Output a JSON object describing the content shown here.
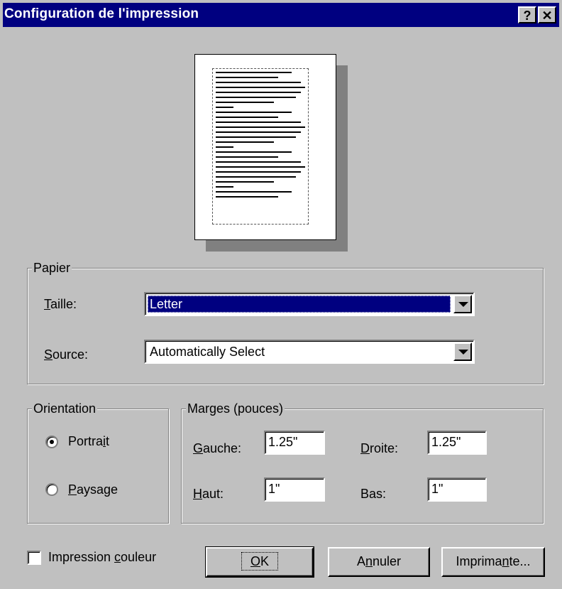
{
  "window": {
    "title": "Configuration de l'impression",
    "help_label": "?",
    "close_label": "✕"
  },
  "paper": {
    "group_label": "Papier",
    "size_label": "Taille:",
    "size_value": "Letter",
    "source_label": "Source:",
    "source_value": "Automatically Select"
  },
  "orientation": {
    "group_label": "Orientation",
    "options": [
      "Portrait",
      "Paysage"
    ],
    "selected": "Portrait"
  },
  "margins": {
    "group_label": "Marges (pouces)",
    "left_label": "Gauche:",
    "left_value": "1.25\"",
    "right_label": "Droite:",
    "right_value": "1.25\"",
    "top_label": "Haut:",
    "top_value": "1\"",
    "bottom_label": "Bas:",
    "bottom_value": "1\""
  },
  "color_print": {
    "label": "Impression couleur",
    "checked": false
  },
  "buttons": {
    "ok": "OK",
    "cancel": "Annuler",
    "printer": "Imprimante..."
  }
}
